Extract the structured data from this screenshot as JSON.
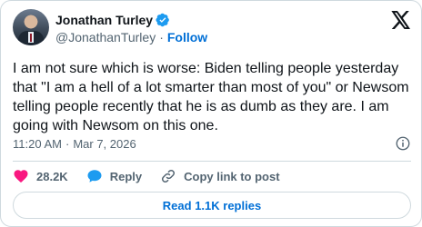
{
  "author": {
    "display_name": "Jonathan Turley",
    "handle": "@JonathanTurley",
    "separator": "·",
    "follow_label": "Follow",
    "verified_color": "#1d9bf0"
  },
  "tweet": {
    "text": "I am not sure which is worse: Biden telling people yesterday that \"I am a hell of a lot smarter than most of you\" or Newsom telling people recently that he is as dumb as they are. I am going with Newsom on this one.",
    "time": "11:20 AM",
    "separator": "·",
    "date": "Mar 7, 2026"
  },
  "actions": {
    "like_count": "28.2K",
    "like_color": "#f91880",
    "reply_label": "Reply",
    "reply_color": "#1d9bf0",
    "copy_label": "Copy link to post"
  },
  "replies_button": {
    "label": "Read 1.1K replies"
  },
  "icons": {
    "brand": "x-logo-icon",
    "verified": "verified-badge-icon",
    "info": "info-icon",
    "like": "heart-icon",
    "reply": "speech-bubble-icon",
    "copy": "link-icon"
  }
}
